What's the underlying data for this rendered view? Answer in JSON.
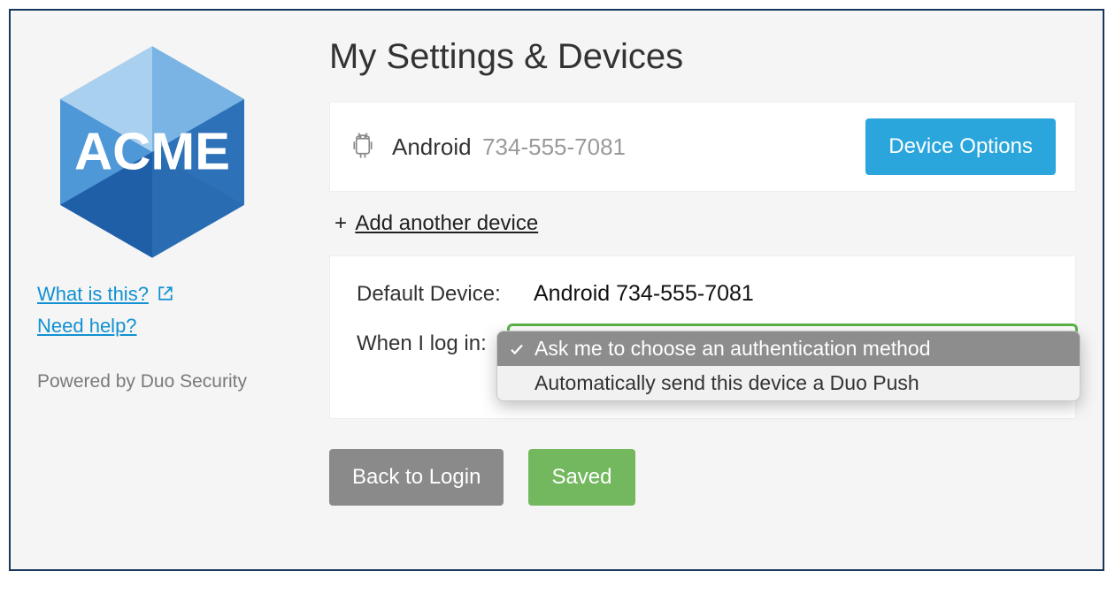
{
  "brand": {
    "name": "ACME"
  },
  "sidebar": {
    "what_is_this": "What is this?",
    "need_help": "Need help?",
    "powered_by": "Powered by Duo Security"
  },
  "title": "My Settings & Devices",
  "device": {
    "platform": "Android",
    "phone": "734-555-7081",
    "options_label": "Device Options"
  },
  "add_device_label": "Add another device",
  "settings": {
    "default_device_label": "Default Device:",
    "default_device_value": "Android 734-555-7081",
    "when_log_in_label": "When I log in:",
    "options": [
      "Ask me to choose an authentication method",
      "Automatically send this device a Duo Push"
    ],
    "selected_index": 0
  },
  "buttons": {
    "back": "Back to Login",
    "saved": "Saved"
  }
}
